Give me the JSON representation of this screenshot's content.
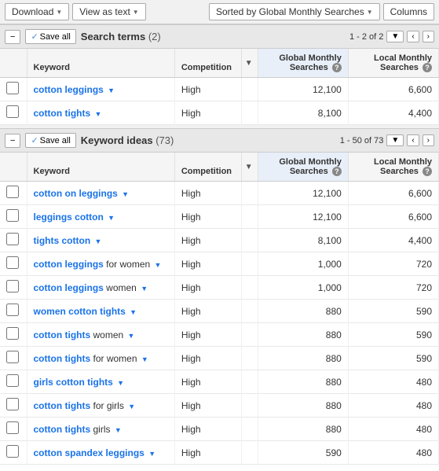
{
  "toolbar": {
    "download_label": "Download",
    "view_as_text_label": "View as text",
    "sorted_by_label": "Sorted by Global Monthly Searches",
    "columns_label": "Columns"
  },
  "search_terms_section": {
    "title": "Search terms",
    "count": "(2)",
    "pagination_text": "1 - 2 of 2",
    "columns": {
      "keyword": "Keyword",
      "competition": "Competition",
      "global_monthly": "Global Monthly Searches",
      "local_monthly": "Local Monthly Searches",
      "help_label": "?"
    },
    "rows": [
      {
        "keyword_bold": "cotton leggings",
        "keyword_rest": "",
        "competition": "High",
        "global": "12,100",
        "local": "6,600"
      },
      {
        "keyword_bold": "cotton tights",
        "keyword_rest": "",
        "competition": "High",
        "global": "8,100",
        "local": "4,400"
      }
    ]
  },
  "keyword_ideas_section": {
    "title": "Keyword ideas",
    "count": "(73)",
    "pagination_text": "1 - 50 of 73",
    "columns": {
      "keyword": "Keyword",
      "competition": "Competition",
      "global_monthly": "Global Monthly Searches",
      "local_monthly": "Local Monthly Searches",
      "help_label": "?"
    },
    "rows": [
      {
        "keyword_bold": "cotton on leggings",
        "keyword_rest": "",
        "competition": "High",
        "global": "12,100",
        "local": "6,600"
      },
      {
        "keyword_bold": "leggings cotton",
        "keyword_rest": "",
        "competition": "High",
        "global": "12,100",
        "local": "6,600"
      },
      {
        "keyword_bold": "tights cotton",
        "keyword_rest": "",
        "competition": "High",
        "global": "8,100",
        "local": "4,400"
      },
      {
        "keyword_bold": "cotton leggings",
        "keyword_rest": " for women",
        "competition": "High",
        "global": "1,000",
        "local": "720"
      },
      {
        "keyword_bold": "cotton leggings",
        "keyword_rest": " women",
        "competition": "High",
        "global": "1,000",
        "local": "720"
      },
      {
        "keyword_bold": "women cotton tights",
        "keyword_rest": "",
        "competition": "High",
        "global": "880",
        "local": "590"
      },
      {
        "keyword_bold": "cotton tights",
        "keyword_rest": " women",
        "competition": "High",
        "global": "880",
        "local": "590"
      },
      {
        "keyword_bold": "cotton tights",
        "keyword_rest": " for women",
        "competition": "High",
        "global": "880",
        "local": "590"
      },
      {
        "keyword_bold": "girls cotton tights",
        "keyword_rest": "",
        "competition": "High",
        "global": "880",
        "local": "480"
      },
      {
        "keyword_bold": "cotton tights",
        "keyword_rest": " for girls",
        "competition": "High",
        "global": "880",
        "local": "480"
      },
      {
        "keyword_bold": "cotton tights",
        "keyword_rest": " girls",
        "competition": "High",
        "global": "880",
        "local": "480"
      },
      {
        "keyword_bold": "cotton spandex leggings",
        "keyword_rest": "",
        "competition": "High",
        "global": "590",
        "local": "480"
      }
    ]
  }
}
